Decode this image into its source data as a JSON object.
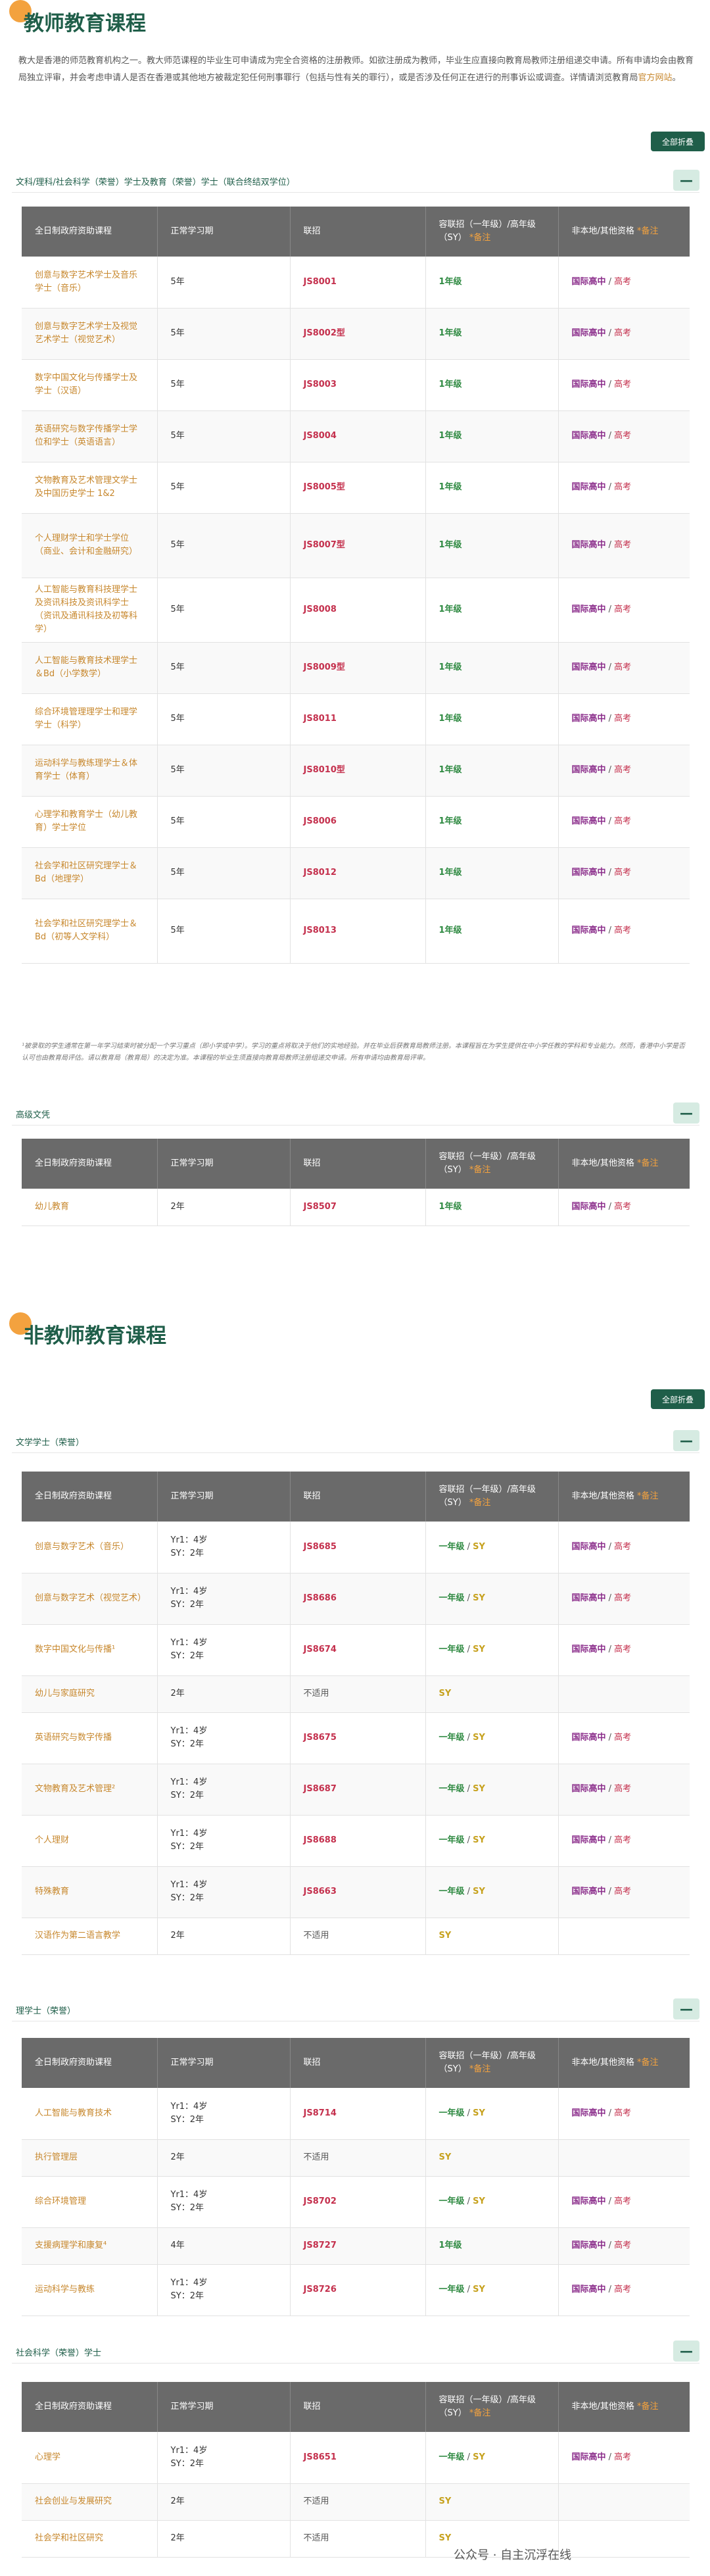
{
  "teacher": {
    "title": "教师教育课程",
    "intro": "教大是香港的师范教育机构之一。教大师范课程的毕业生可申请成为完全合资格的注册教师。如欲注册成为教师，毕业生应直接向教育局教师注册组递交申请。所有申请均会由教育局独立评审，并会考虑申请人是否在香港或其他地方被裁定犯任何刑事罪行（包括与性有关的罪行），或是否涉及任何正在进行的刑事诉讼或调查。详情请浏览教育局",
    "intro_link": "官方网站",
    "intro_end": "。",
    "collapse_all": "全部折叠",
    "cat1": "文科/理科/社会科学（荣誉）学士及教育（荣誉）学士（联合终结双学位）",
    "cat2": "高级文凭"
  },
  "nonteacher": {
    "title": "非教师教育课程",
    "collapse_all": "全部折叠",
    "cat1": "文学学士（荣誉）",
    "cat2": "理学士（荣誉）",
    "cat3": "社会科学（荣誉）学士"
  },
  "headers": {
    "program": "全日制政府资助课程",
    "duration": "正常学习期",
    "jupas": "联招",
    "entry_pre": "容联招（一年级）/高年级（SY）",
    "entry_star": "*备注",
    "nonlocal_pre": "非本地/其他资格",
    "nonlocal_star": "*备注"
  },
  "teacher_rows": [
    {
      "name": "创意与数字艺术学士及音乐学士（音乐）",
      "dur": "5年",
      "code": "JS8001",
      "entry": "1年级",
      "qual": "国际高中",
      "gk": "高考"
    },
    {
      "name": "创意与数字艺术学士及视觉艺术学士（视觉艺术）",
      "dur": "5年",
      "code": "JS8002型",
      "entry": "1年级",
      "qual": "国际高中",
      "gk": "高考"
    },
    {
      "name": "数字中国文化与传播学士及学士（汉语）",
      "dur": "5年",
      "code": "JS8003",
      "entry": "1年级",
      "qual": "国际高中",
      "gk": "高考"
    },
    {
      "name": "英语研究与数字传播学士学位和学士（英语语言）",
      "dur": "5年",
      "code": "JS8004",
      "entry": "1年级",
      "qual": "国际高中",
      "gk": "高考"
    },
    {
      "name": "文物教育及艺术管理文学士及中国历史学士 1&2",
      "dur": "5年",
      "code": "JS8005型",
      "entry": "1年级",
      "qual": "国际高中",
      "gk": "高考"
    },
    {
      "name": "个人理财学士和学士学位（商业、会计和金融研究）",
      "dur": "5年",
      "code": "JS8007型",
      "entry": "1年级",
      "qual": "国际高中",
      "gk": "高考"
    },
    {
      "name": "人工智能与教育科技理学士及资讯科技及资讯科学士（资讯及通讯科技及初等科学）",
      "dur": "5年",
      "code": "JS8008",
      "entry": "1年级",
      "qual": "国际高中",
      "gk": "高考"
    },
    {
      "name": "人工智能与教育技术理学士＆Bd（小学数学）",
      "dur": "5年",
      "code": "JS8009型",
      "entry": "1年级",
      "qual": "国际高中",
      "gk": "高考"
    },
    {
      "name": "综合环境管理理学士和理学学士（科学）",
      "dur": "5年",
      "code": "JS8011",
      "entry": "1年级",
      "qual": "国际高中",
      "gk": "高考"
    },
    {
      "name": "运动科学与教练理学士＆体育学士（体育）",
      "dur": "5年",
      "code": "JS8010型",
      "entry": "1年级",
      "qual": "国际高中",
      "gk": "高考"
    },
    {
      "name": "心理学和教育学士（幼儿教育）学士学位",
      "dur": "5年",
      "code": "JS8006",
      "entry": "1年级",
      "qual": "国际高中",
      "gk": "高考"
    },
    {
      "name": "社会学和社区研究理学士＆Bd（地理学）",
      "dur": "5年",
      "code": "JS8012",
      "entry": "1年级",
      "qual": "国际高中",
      "gk": "高考"
    },
    {
      "name": "社会学和社区研究理学士＆Bd（初等人文学科）",
      "dur": "5年",
      "code": "JS8013",
      "entry": "1年级",
      "qual": "国际高中",
      "gk": "高考"
    }
  ],
  "teacher_footnote": "¹被录取的学生通常在第一年学习结束时被分配一个学习重点（即小学或中学）。学习的重点将取决于他们的实地经验。并在毕业后获教育局教师注册。本课程旨在为学生提供在中小学任教的学科和专业能力。然而，香港中小学是否认可也由教育局评估。请以教育局（教育局）的决定为准。本课程的毕业生须直接向教育局教师注册组递交申请。所有申请均由教育局评审。",
  "hd_rows": [
    {
      "name": "幼儿教育",
      "dur": "2年",
      "code": "JS8507",
      "entry": "1年级",
      "qual": "国际高中",
      "gk": "高考"
    }
  ],
  "ba_rows": [
    {
      "name": "创意与数字艺术（音乐）",
      "dur1": "Yr1：4岁",
      "dur2": "SY：2年",
      "code": "JS8685",
      "entry": "一年级",
      "sy": "SY",
      "qual": "国际高中",
      "gk": "高考"
    },
    {
      "name": "创意与数字艺术（视觉艺术）",
      "dur1": "Yr1：4岁",
      "dur2": "SY：2年",
      "code": "JS8686",
      "entry": "一年级",
      "sy": "SY",
      "qual": "国际高中",
      "gk": "高考"
    },
    {
      "name": "数字中国文化与传播¹",
      "dur1": "Yr1：4岁",
      "dur2": "SY：2年",
      "code": "JS8674",
      "entry": "一年级",
      "sy": "SY",
      "qual": "国际高中",
      "gk": "高考"
    },
    {
      "name": "幼儿与家庭研究",
      "dur1": "2年",
      "dur2": "",
      "code": "不适用",
      "entry": "",
      "sy": "SY",
      "qual": "",
      "gk": ""
    },
    {
      "name": "英语研究与数字传播",
      "dur1": "Yr1：4岁",
      "dur2": "SY：2年",
      "code": "JS8675",
      "entry": "一年级",
      "sy": "SY",
      "qual": "国际高中",
      "gk": "高考"
    },
    {
      "name": "文物教育及艺术管理²",
      "dur1": "Yr1：4岁",
      "dur2": "SY：2年",
      "code": "JS8687",
      "entry": "一年级",
      "sy": "SY",
      "qual": "国际高中",
      "gk": "高考"
    },
    {
      "name": "个人理财",
      "dur1": "Yr1：4岁",
      "dur2": "SY：2年",
      "code": "JS8688",
      "entry": "一年级",
      "sy": "SY",
      "qual": "国际高中",
      "gk": "高考"
    },
    {
      "name": "特殊教育",
      "dur1": "Yr1：4岁",
      "dur2": "SY：2年",
      "code": "JS8663",
      "entry": "一年级",
      "sy": "SY",
      "qual": "国际高中",
      "gk": "高考"
    },
    {
      "name": "汉语作为第二语言教学",
      "dur1": "2年",
      "dur2": "",
      "code": "不适用",
      "entry": "",
      "sy": "SY",
      "qual": "",
      "gk": ""
    }
  ],
  "bsc_rows": [
    {
      "name": "人工智能与教育技术",
      "dur1": "Yr1：4岁",
      "dur2": "SY：2年",
      "code": "JS8714",
      "entry": "一年级",
      "sy": "SY",
      "qual": "国际高中",
      "gk": "高考"
    },
    {
      "name": "执行管理层",
      "dur1": "2年",
      "dur2": "",
      "code": "不适用",
      "entry": "",
      "sy": "SY",
      "qual": "",
      "gk": ""
    },
    {
      "name": "综合环境管理",
      "dur1": "Yr1：4岁",
      "dur2": "SY：2年",
      "code": "JS8702",
      "entry": "一年级",
      "sy": "SY",
      "qual": "国际高中",
      "gk": "高考"
    },
    {
      "name": "支援病理学和康复⁴",
      "dur1": "4年",
      "dur2": "",
      "code": "JS8727",
      "entry": "1年级",
      "sy": "",
      "qual": "国际高中",
      "gk": "高考"
    },
    {
      "name": "运动科学与教练",
      "dur1": "Yr1：4岁",
      "dur2": "SY：2年",
      "code": "JS8726",
      "entry": "一年级",
      "sy": "SY",
      "qual": "国际高中",
      "gk": "高考"
    }
  ],
  "bss_rows": [
    {
      "name": "心理学",
      "dur1": "Yr1：4岁",
      "dur2": "SY：2年",
      "code": "JS8651",
      "entry": "一年级",
      "sy": "SY",
      "qual": "国际高中",
      "gk": "高考"
    },
    {
      "name": "社会创业与发展研究",
      "dur1": "2年",
      "dur2": "",
      "code": "不适用",
      "entry": "",
      "sy": "SY",
      "qual": "",
      "gk": ""
    },
    {
      "name": "社会学和社区研究",
      "dur1": "2年",
      "dur2": "",
      "code": "不适用",
      "entry": "",
      "sy": "SY",
      "qual": "",
      "gk": ""
    }
  ],
  "watermark": "公众号 · 自主沉浮在线"
}
